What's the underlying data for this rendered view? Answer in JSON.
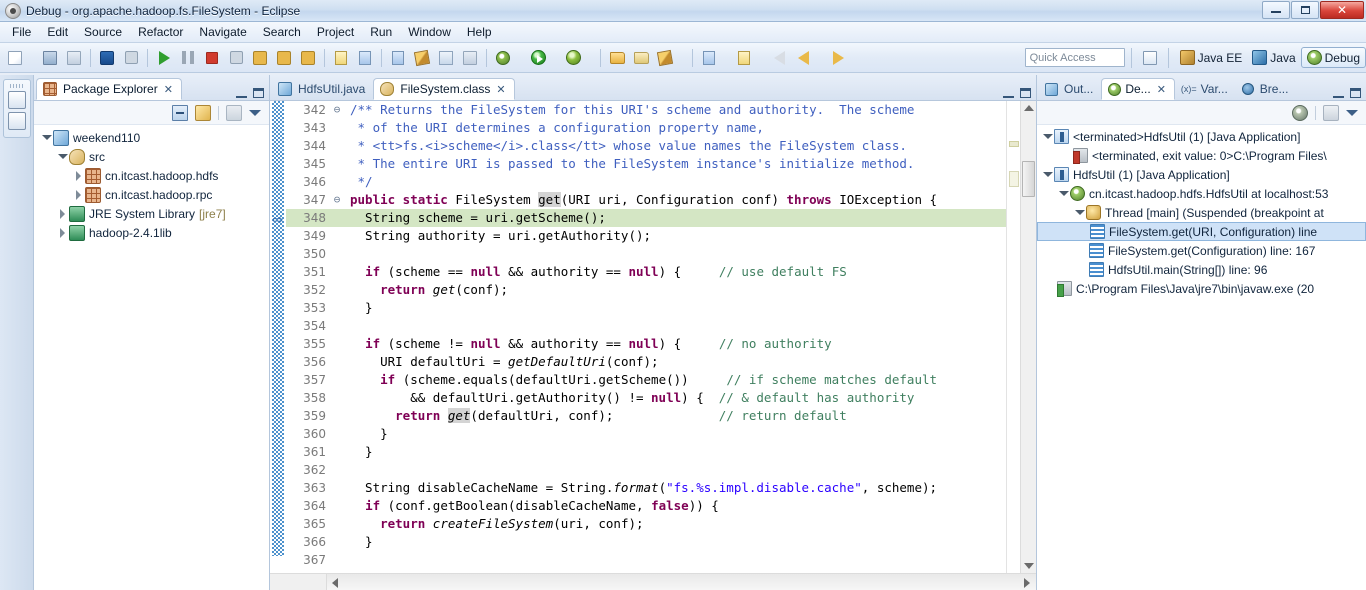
{
  "window": {
    "title": "Debug - org.apache.hadoop.fs.FileSystem - Eclipse",
    "app_icon": "eclipse-icon",
    "controls": {
      "minimize": "minimize-button",
      "maximize": "maximize-button",
      "close": "close-button"
    }
  },
  "menubar": {
    "items": [
      "File",
      "Edit",
      "Source",
      "Refactor",
      "Navigate",
      "Search",
      "Project",
      "Run",
      "Window",
      "Help"
    ]
  },
  "toolbar": {
    "quick_access_placeholder": "Quick Access",
    "perspectives": [
      {
        "label": "Java EE",
        "icon": "java-ee-perspective-icon",
        "active": false
      },
      {
        "label": "Java",
        "icon": "java-perspective-icon",
        "active": false
      },
      {
        "label": "Debug",
        "icon": "debug-perspective-icon",
        "active": true
      }
    ],
    "open_perspective_label": "Open Perspective"
  },
  "package_explorer": {
    "tab_label": "Package Explorer",
    "tree": [
      {
        "label": "weekend110",
        "icon": "java-project-icon",
        "indent": 0,
        "twist": "open"
      },
      {
        "label": "src",
        "icon": "source-folder-icon",
        "indent": 1,
        "twist": "open"
      },
      {
        "label": "cn.itcast.hadoop.hdfs",
        "icon": "package-icon",
        "indent": 2,
        "twist": "closed"
      },
      {
        "label": "cn.itcast.hadoop.rpc",
        "icon": "package-icon",
        "indent": 2,
        "twist": "closed"
      },
      {
        "label": "JRE System Library",
        "suffix": "[jre7]",
        "icon": "library-icon",
        "indent": 1,
        "twist": "closed"
      },
      {
        "label": "hadoop-2.4.1lib",
        "icon": "library-icon",
        "indent": 1,
        "twist": "closed"
      }
    ]
  },
  "editor": {
    "tabs": [
      {
        "label": "HdfsUtil.java",
        "icon": "java-file-icon",
        "active": false,
        "closeable": false
      },
      {
        "label": "FileSystem.class",
        "icon": "class-file-icon",
        "active": true,
        "closeable": true
      }
    ],
    "first_line": 342,
    "current_line": 348,
    "highlight_color": "#d4e6c4",
    "lines": [
      {
        "n": 342,
        "fold": "⊖",
        "html": "<span class='jdoc'>/** Returns the FileSystem for this URI's scheme and authority.  The scheme</span>"
      },
      {
        "n": 343,
        "fold": "",
        "html": " <span class='jdoc'>* of the URI determines a configuration property name,</span>"
      },
      {
        "n": 344,
        "fold": "",
        "html": " <span class='jdoc'>* &lt;tt&gt;fs.&lt;i&gt;scheme&lt;/i&gt;.class&lt;/tt&gt; whose value names the FileSystem class.</span>"
      },
      {
        "n": 345,
        "fold": "",
        "html": " <span class='jdoc'>* The entire URI is passed to the FileSystem instance's initialize method.</span>"
      },
      {
        "n": 346,
        "fold": "",
        "html": " <span class='jdoc'>*/</span>"
      },
      {
        "n": 347,
        "fold": "⊖",
        "html": "<span class='kw'>public static</span> FileSystem <span class='sel-token'>get</span>(URI uri, Configuration conf) <span class='kw'>throws</span> IOException {"
      },
      {
        "n": 348,
        "fold": "",
        "html": "  String scheme = uri.getScheme();",
        "current": true
      },
      {
        "n": 349,
        "fold": "",
        "html": "  String authority = uri.getAuthority();"
      },
      {
        "n": 350,
        "fold": "",
        "html": ""
      },
      {
        "n": 351,
        "fold": "",
        "html": "  <span class='kw'>if</span> (scheme == <span class='kw'>null</span> &amp;&amp; authority == <span class='kw'>null</span>) {     <span class='cmt'>// use default FS</span>"
      },
      {
        "n": 352,
        "fold": "",
        "html": "    <span class='kw'>return</span> <span class='stat'>get</span>(conf);"
      },
      {
        "n": 353,
        "fold": "",
        "html": "  }"
      },
      {
        "n": 354,
        "fold": "",
        "html": ""
      },
      {
        "n": 355,
        "fold": "",
        "html": "  <span class='kw'>if</span> (scheme != <span class='kw'>null</span> &amp;&amp; authority == <span class='kw'>null</span>) {     <span class='cmt'>// no authority</span>"
      },
      {
        "n": 356,
        "fold": "",
        "html": "    URI defaultUri = <span class='stat'>getDefaultUri</span>(conf);"
      },
      {
        "n": 357,
        "fold": "",
        "html": "    <span class='kw'>if</span> (scheme.equals(defaultUri.getScheme())     <span class='cmt'>// if scheme matches default</span>"
      },
      {
        "n": 358,
        "fold": "",
        "html": "        &amp;&amp; defaultUri.getAuthority() != <span class='kw'>null</span>) {  <span class='cmt'>// &amp; default has authority</span>"
      },
      {
        "n": 359,
        "fold": "",
        "html": "      <span class='kw'>return</span> <span class='stat sel-token'>get</span>(defaultUri, conf);              <span class='cmt'>// return default</span>"
      },
      {
        "n": 360,
        "fold": "",
        "html": "    }"
      },
      {
        "n": 361,
        "fold": "",
        "html": "  }"
      },
      {
        "n": 362,
        "fold": "",
        "html": ""
      },
      {
        "n": 363,
        "fold": "",
        "html": "  String disableCacheName = String.<span class='stat'>format</span>(<span class='str'>\"fs.%s.impl.disable.cache\"</span>, scheme);"
      },
      {
        "n": 364,
        "fold": "",
        "html": "  <span class='kw'>if</span> (conf.getBoolean(disableCacheName, <span class='kw'>false</span>)) {"
      },
      {
        "n": 365,
        "fold": "",
        "html": "    <span class='kw'>return</span> <span class='stat'>createFileSystem</span>(uri, conf);"
      },
      {
        "n": 366,
        "fold": "",
        "html": "  }"
      },
      {
        "n": 367,
        "fold": "",
        "html": ""
      }
    ]
  },
  "debug_view": {
    "tabs": [
      {
        "label": "Out...",
        "icon": "outline-icon",
        "active": false,
        "closeable": false
      },
      {
        "label": "De...",
        "icon": "debug-icon",
        "active": true,
        "closeable": true
      },
      {
        "label": "Var...",
        "icon": "variables-icon",
        "active": false,
        "closeable": false,
        "prefix": "(x)="
      },
      {
        "label": "Bre...",
        "icon": "breakpoints-icon",
        "active": false,
        "closeable": false
      }
    ],
    "tree": [
      {
        "label": "<terminated>HdfsUtil (1) [Java Application]",
        "icon": "launch-icon",
        "indent": 0,
        "twist": "open",
        "selected": false
      },
      {
        "label": "<terminated, exit value: 0>C:\\Program Files\\",
        "icon": "process-terminated-icon",
        "indent": 1,
        "twist": "none",
        "selected": false
      },
      {
        "label": "HdfsUtil (1) [Java Application]",
        "icon": "launch-icon",
        "indent": 0,
        "twist": "open",
        "selected": false
      },
      {
        "label": "cn.itcast.hadoop.hdfs.HdfsUtil at localhost:53",
        "icon": "debug-target-icon",
        "indent": 1,
        "twist": "open",
        "selected": false
      },
      {
        "label": "Thread [main] (Suspended (breakpoint at",
        "icon": "thread-suspended-icon",
        "indent": 2,
        "twist": "open",
        "selected": false
      },
      {
        "label": "FileSystem.get(URI, Configuration) line",
        "icon": "stack-frame-icon",
        "indent": 3,
        "twist": "none",
        "selected": true
      },
      {
        "label": "FileSystem.get(Configuration) line: 167",
        "icon": "stack-frame-icon",
        "indent": 3,
        "twist": "none",
        "selected": false
      },
      {
        "label": "HdfsUtil.main(String[]) line: 96",
        "icon": "stack-frame-icon",
        "indent": 3,
        "twist": "none",
        "selected": false
      },
      {
        "label": "C:\\Program Files\\Java\\jre7\\bin\\javaw.exe (20",
        "icon": "process-running-icon",
        "indent": 1,
        "twist": "none",
        "selected": false
      }
    ]
  }
}
